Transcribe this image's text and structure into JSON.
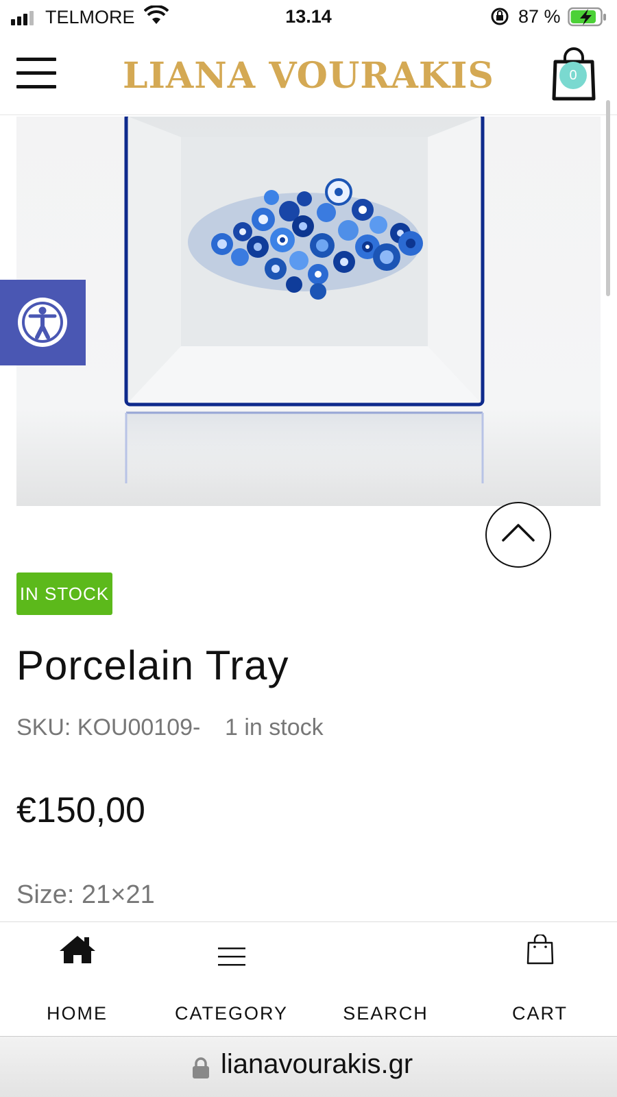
{
  "status_bar": {
    "carrier": "TELMORE",
    "time": "13.14",
    "battery_percent": "87 %",
    "battery_level": 0.87
  },
  "header": {
    "logo": "LIANA VOURAKIS",
    "cart_count": "0",
    "colors": {
      "logo": "#d4a954",
      "cart_badge": "#7ad9d0"
    }
  },
  "product": {
    "stock_badge": "IN STOCK",
    "title": "Porcelain Tray",
    "sku": "SKU: KOU00109-",
    "stock_text": "1 in stock",
    "price": "€150,00",
    "size": "Size: 21×21",
    "colors": {
      "stock_badge": "#5cb91b"
    }
  },
  "accessibility": {
    "icon": "accessibility-icon",
    "color": "#4a57b3"
  },
  "back_to_top": {
    "icon": "chevron-up-icon"
  },
  "bottom_nav": {
    "items": [
      {
        "label": "HOME",
        "icon": "home-icon"
      },
      {
        "label": "CATEGORY",
        "icon": "menu-icon"
      },
      {
        "label": "SEARCH",
        "icon": ""
      },
      {
        "label": "CART",
        "icon": "shopping-bag-icon"
      }
    ]
  },
  "url_bar": {
    "url": "lianavourakis.gr",
    "icon": "lock-icon"
  }
}
